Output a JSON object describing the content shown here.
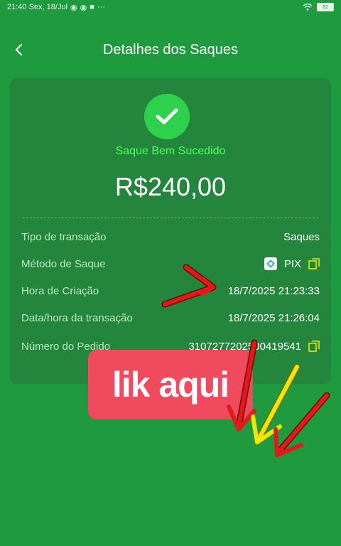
{
  "status_bar": {
    "time": "21:40 Sex, 18/Jul",
    "dots": "···",
    "battery": "82"
  },
  "header": {
    "title": "Detalhes dos Saques"
  },
  "card": {
    "status": "Saque Bem Sucedido",
    "amount": "R$240,00",
    "rows": [
      {
        "label": "Tipo de transação",
        "value": "Saques"
      },
      {
        "label": "Método de Saque",
        "value": "PIX"
      },
      {
        "label": "Hora de Criação",
        "value": "18/7/2025 21:23:33"
      },
      {
        "label": "Data/hora da transação",
        "value": "18/7/2025 21:26:04"
      },
      {
        "label": "Número do Pedido",
        "value": "3107277202500419541"
      }
    ]
  },
  "overlay": {
    "text": "lik aqui"
  },
  "colors": {
    "background": "#1f9a3f",
    "card": "#24863d",
    "success": "#2ed14b",
    "overlay": "#f04a5f",
    "arrow_red": "#e01b1b",
    "arrow_yellow": "#f2e600"
  }
}
